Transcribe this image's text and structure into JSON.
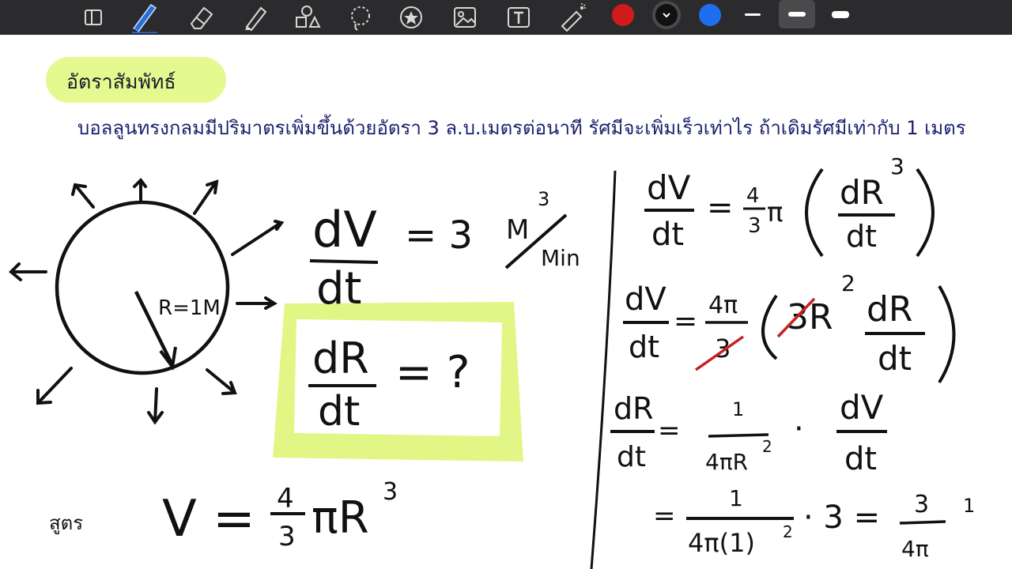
{
  "toolbar": {
    "tools": [
      {
        "name": "layout-icon"
      },
      {
        "name": "pen-icon",
        "selected": true
      },
      {
        "name": "eraser-icon"
      },
      {
        "name": "highlighter-icon"
      },
      {
        "name": "shapes-icon"
      },
      {
        "name": "lasso-icon"
      },
      {
        "name": "sticker-icon"
      },
      {
        "name": "image-icon"
      },
      {
        "name": "text-icon"
      },
      {
        "name": "laser-pointer-icon"
      }
    ],
    "colors": [
      "#d11a1a",
      "#111111",
      "#1e6ff0"
    ],
    "selected_color": "#111111",
    "stroke_widths": [
      "thin",
      "medium",
      "thick"
    ],
    "selected_stroke": "medium"
  },
  "note": {
    "title": "อัตราสัมพัทธ์",
    "problem": "บอลลูนทรงกลมมีปริมาตรเพิ่มขึ้นด้วยอัตรา 3 ล.บ.เมตรต่อนาที รัศมีจะเพิ่มเร็วเท่าไร ถ้าเดิมรัศมีเท่ากับ 1 เมตร"
  },
  "handwriting": {
    "radius_label": "R=1M.",
    "given_lhs_top": "dV",
    "given_lhs_bottom": "dt",
    "given_rhs": "= 3",
    "given_unit_num": "M",
    "given_unit_exp": "3",
    "given_unit_den": "Min",
    "goal_top": "dR",
    "goal_bottom": "dt",
    "goal_rhs": "= ?",
    "formula_prefix": "สูตร",
    "formula_v": "V =",
    "formula_num": "4",
    "formula_den": "3",
    "formula_tail": "πR",
    "formula_exp": "3",
    "r1_lhs_top": "dV",
    "r1_lhs_bottom": "dt",
    "r1_eq": "=",
    "r1_coef_top": "4",
    "r1_coef_bottom": "3",
    "r1_pi": "π",
    "r1_inner_top": "dR",
    "r1_inner_bottom": "dt",
    "r1_exp": "3",
    "r2_lhs_top": "dV",
    "r2_lhs_bottom": "dt",
    "r2_eq": "=",
    "r2_coef_top": "4π",
    "r2_coef_bottom": "3",
    "r2_mid": "3R",
    "r2_exp": "2",
    "r2_inner_top": "dR",
    "r2_inner_bottom": "dt",
    "r3_lhs_top": "dR",
    "r3_lhs_bottom": "dt",
    "r3_eq": "=",
    "r3_frac_top": "1",
    "r3_frac_bottom": "4πR",
    "r3_frac_exp": "2",
    "r3_dot": "·",
    "r3_tail_top": "dV",
    "r3_tail_bottom": "dt",
    "r4_eq": "=",
    "r4_frac_top": "1",
    "r4_frac_bottom": "4π(1)",
    "r4_frac_exp": "2",
    "r4_mult": "· 3 =",
    "r4_res_top": "3",
    "r4_res_bottom": "4π",
    "r4_tail": "1"
  }
}
